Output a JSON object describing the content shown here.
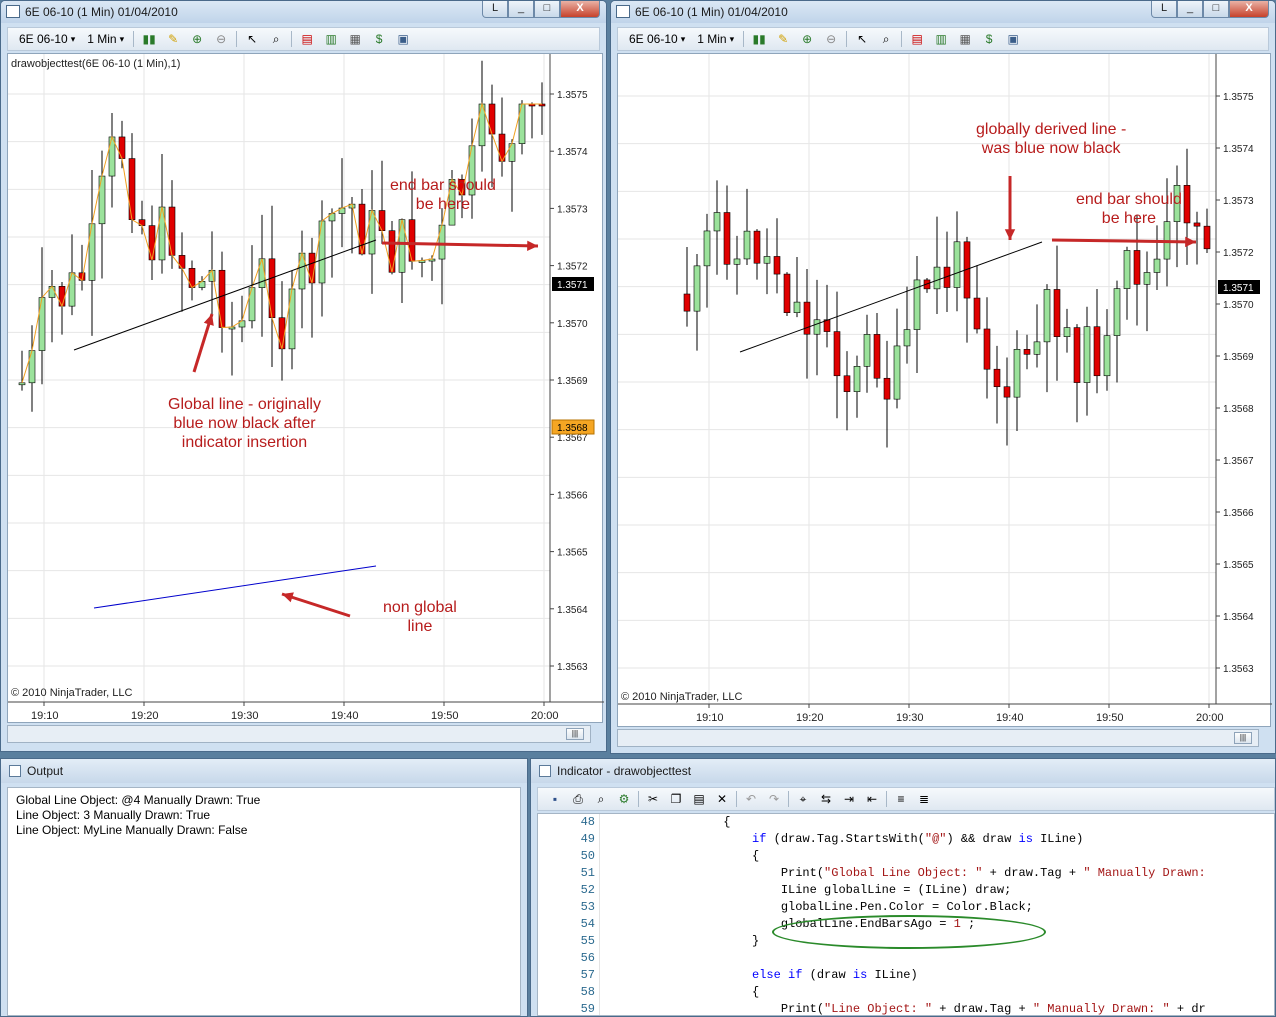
{
  "left_window": {
    "title": "6E 06-10 (1 Min)  01/04/2010",
    "instrument": "6E 06-10",
    "interval": "1 Min",
    "caption_buttons": [
      "L",
      "_",
      "□",
      "X"
    ],
    "indicator_label": "drawobjecttest(6E 06-10 (1 Min),1)",
    "copyright": "© 2010 NinjaTrader, LLC",
    "price_labels": [
      "1.3575",
      "1.3574",
      "1.3573",
      "1.3572",
      "1.3570",
      "1.3569",
      "1.3567",
      "1.3566",
      "1.3565",
      "1.3564",
      "1.3563"
    ],
    "last_price_tag": "1.3571",
    "orange_price_tag": "1.3568",
    "time_labels": [
      "19:10",
      "19:20",
      "19:30",
      "19:40",
      "19:50",
      "20:00"
    ],
    "annotations": {
      "end_bar": "end bar should\nbe here",
      "global_line": "Global line - originally\nblue now black after\nindicator insertion",
      "non_global": "non global\nline"
    }
  },
  "right_window": {
    "title": "6E 06-10 (1 Min)  01/04/2010",
    "instrument": "6E 06-10",
    "interval": "1 Min",
    "caption_buttons": [
      "L",
      "_",
      "□",
      "X"
    ],
    "copyright": "© 2010 NinjaTrader, LLC",
    "price_labels": [
      "1.3575",
      "1.3574",
      "1.3573",
      "1.3572",
      "1.3570",
      "1.3569",
      "1.3568",
      "1.3567",
      "1.3566",
      "1.3565",
      "1.3564",
      "1.3563"
    ],
    "last_price_tag": "1.3571",
    "time_labels": [
      "19:10",
      "19:20",
      "19:30",
      "19:40",
      "19:50",
      "20:00"
    ],
    "annotations": {
      "derived": "globally derived line -\nwas blue now black",
      "end_bar": "end bar should\nbe here"
    }
  },
  "output_panel": {
    "title": "Output",
    "lines": [
      "Global Line Object: @4 Manually Drawn: True",
      "Line Object: 3 Manually Drawn: True",
      "Line Object: MyLine Manually Drawn: False"
    ]
  },
  "indicator_panel": {
    "title": "Indicator - drawobjecttest",
    "line_numbers": [
      "48",
      "49",
      "50",
      "51",
      "52",
      "53",
      "54",
      "55",
      "56",
      "57",
      "58",
      "59"
    ]
  },
  "colors": {
    "up_bar": "#9be29b",
    "down_bar": "#e00000",
    "annotation": "#b71c1c",
    "global_line": "#000000",
    "non_global_line": "#0000cc",
    "indicator_plot": "#f0a020"
  }
}
